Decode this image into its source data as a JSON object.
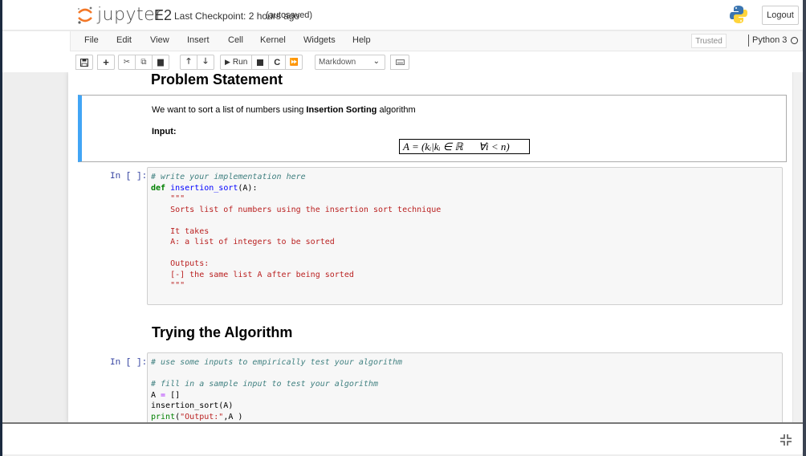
{
  "header": {
    "logo_text": "jupyter",
    "notebook_name": "E2",
    "checkpoint": "Last Checkpoint: 2 hours ago",
    "autosave": "(autosaved)",
    "logout_label": "Logout"
  },
  "menubar": {
    "items": [
      "File",
      "Edit",
      "View",
      "Insert",
      "Cell",
      "Kernel",
      "Widgets",
      "Help"
    ],
    "trusted_label": "Trusted",
    "kernel_name": "Python 3"
  },
  "toolbar": {
    "run_label": "Run",
    "cell_type": "Markdown",
    "icons": [
      "save-icon",
      "add-cell-icon",
      "cut-icon",
      "copy-icon",
      "paste-icon",
      "move-up-icon",
      "move-down-icon",
      "run-icon",
      "stop-icon",
      "restart-icon",
      "fast-forward-icon",
      "keyboard-icon"
    ]
  },
  "cells": {
    "heading1": "Problem Statement",
    "markdown": {
      "text_before": "We want to sort a list of numbers using ",
      "text_bold": "Insertion Sorting",
      "text_after": " algorithm",
      "input_label": "Input:",
      "formula": "A = (kᵢ|kᵢ ∈ ℝ      ∀i < n)"
    },
    "code1": {
      "prompt": "In [ ]:",
      "lines": [
        "# write your implementation here",
        "def insertion_sort(A):",
        "    \"\"\"",
        "    Sorts list of numbers using the insertion sort technique",
        "",
        "    It takes",
        "    A: a list of integers to be sorted",
        "",
        "    Outputs:",
        "    [-] the same list A after being sorted",
        "    \"\"\""
      ]
    },
    "heading2": "Trying the Algorithm",
    "code2": {
      "prompt": "In [ ]:",
      "lines": [
        "# use some inputs to empirically test your algorithm",
        "",
        "# fill in a sample input to test your algorithm",
        "A = []",
        "insertion_sort(A)",
        "print(\"Output:\",A )"
      ]
    }
  }
}
